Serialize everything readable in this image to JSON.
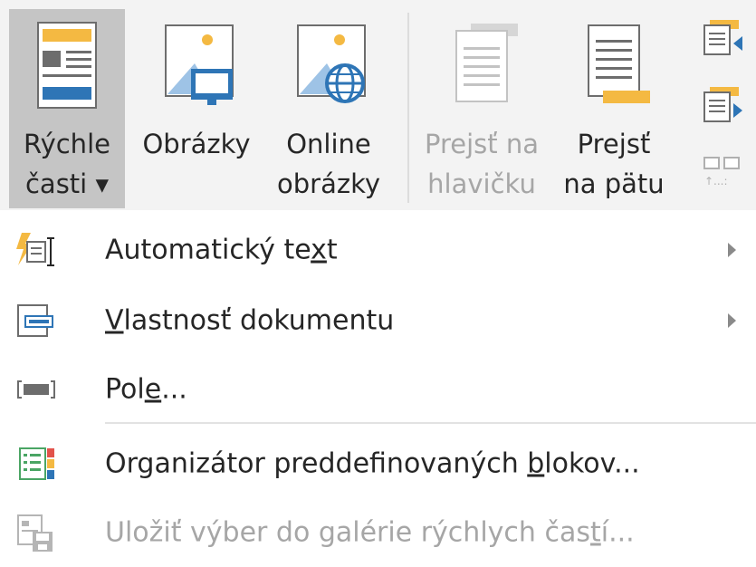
{
  "ribbon": {
    "quick_parts": {
      "line1": "Rýchle",
      "line2": "časti ▾"
    },
    "pictures": {
      "line1": "Obrázky"
    },
    "online_pictures": {
      "line1": "Online",
      "line2": "obrázky"
    },
    "go_to_header": {
      "line1": "Prejsť na",
      "line2": "hlavičku"
    },
    "go_to_footer": {
      "line1": "Prejsť",
      "line2": "na pätu"
    }
  },
  "menu": {
    "items": [
      {
        "pre": "Automatický te",
        "u": "x",
        "post": "t",
        "icon": "autotext-icon",
        "submenu": true,
        "enabled": true
      },
      {
        "pre": "",
        "u": "V",
        "post": "lastnosť dokumentu",
        "icon": "document-property-icon",
        "submenu": true,
        "enabled": true
      },
      {
        "pre": "Pol",
        "u": "e",
        "post": "...",
        "icon": "field-icon",
        "submenu": false,
        "enabled": true
      },
      {
        "pre": "Organizátor preddefinovaných ",
        "u": "b",
        "post": "lokov...",
        "icon": "building-blocks-organizer-icon",
        "submenu": false,
        "enabled": true
      },
      {
        "pre": "Uložiť výber do galérie rýchlych čas",
        "u": "t",
        "post": "í...",
        "icon": "save-selection-icon",
        "submenu": false,
        "enabled": false
      }
    ]
  },
  "colors": {
    "accent_blue": "#2e75b6",
    "accent_orange": "#f4b942",
    "disabled_text": "#a6a6a6",
    "active_bg": "#c5c5c5"
  }
}
